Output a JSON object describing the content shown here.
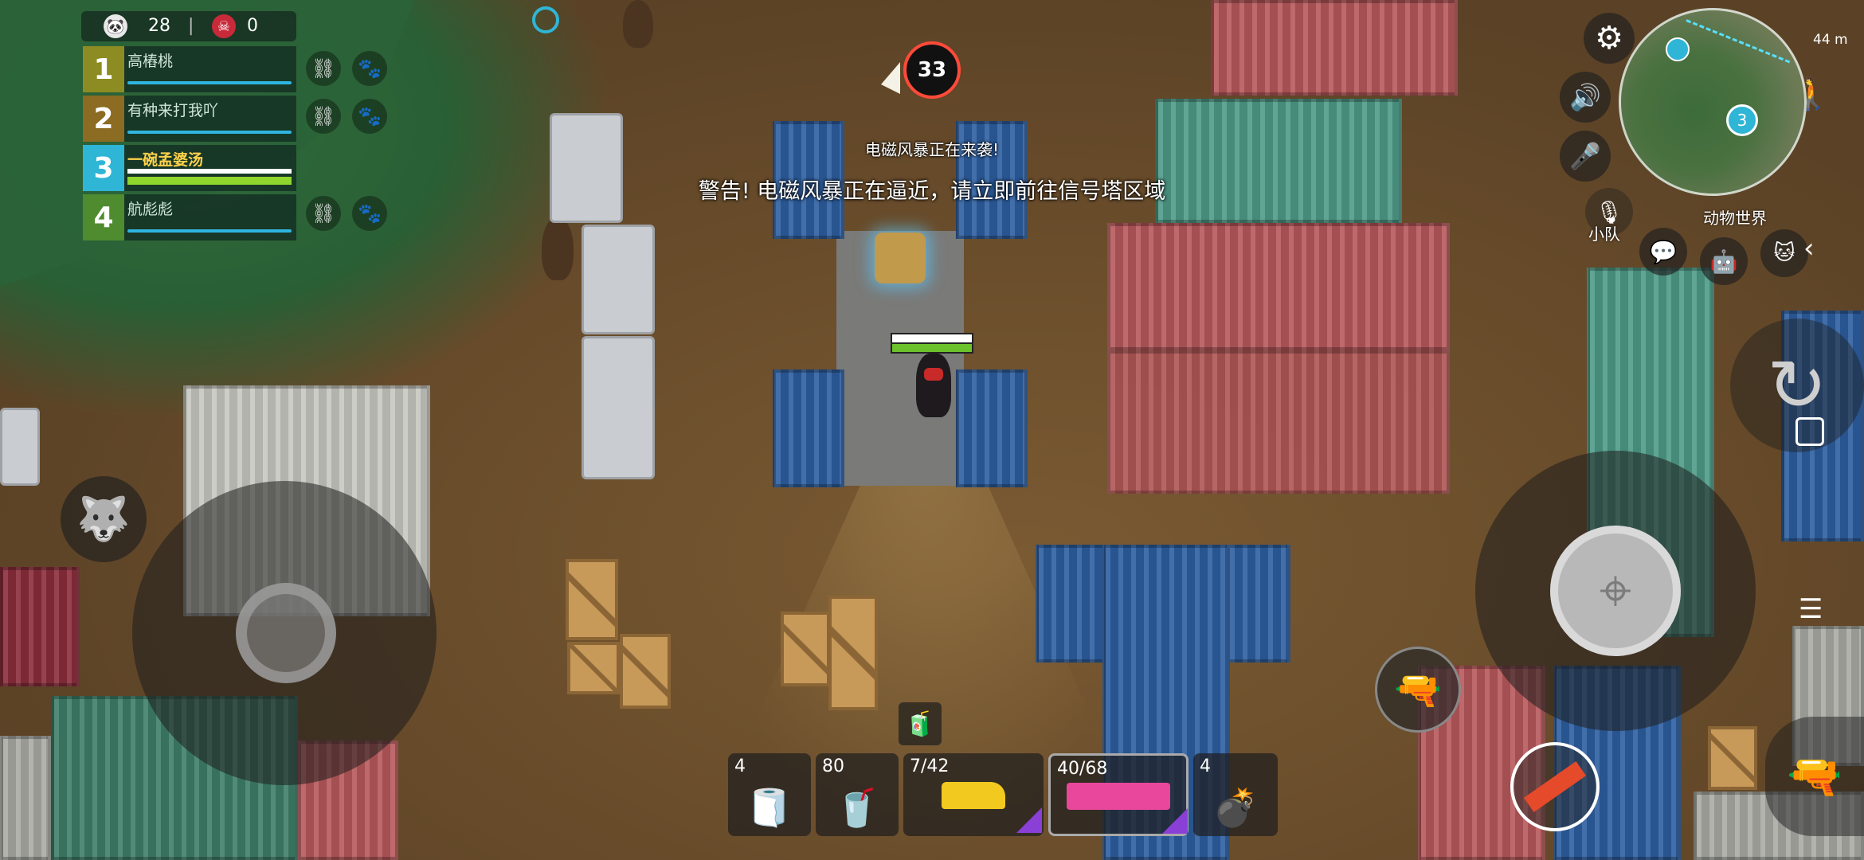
{
  "score": {
    "alive_count": "28",
    "kills": "0"
  },
  "team": [
    {
      "num": "1",
      "name": "高樁桃",
      "color": "#8c8c22"
    },
    {
      "num": "2",
      "name": "有种来打我吖",
      "color": "#8c6b22"
    },
    {
      "num": "3",
      "name": "一碗孟婆汤",
      "color": "#2fb5d6"
    },
    {
      "num": "4",
      "name": "航彪彪",
      "color": "#4f8b2f"
    }
  ],
  "timer": "33",
  "warning": {
    "small": "电磁风暴正在来袭!",
    "big": "警告! 电磁风暴正在逼近，请立即前往信号塔区域"
  },
  "inventory": [
    {
      "count": "4",
      "icon": "tape-icon"
    },
    {
      "count": "80",
      "icon": "medkit-icon"
    },
    {
      "count": "7/42",
      "icon": "pistol-icon"
    },
    {
      "count": "40/68",
      "icon": "smg-icon"
    },
    {
      "count": "4",
      "icon": "grenade-icon"
    }
  ],
  "minimap": {
    "label": "动物世界",
    "waypoint": "3"
  },
  "team_voice_label": "小队",
  "network": "44 m"
}
